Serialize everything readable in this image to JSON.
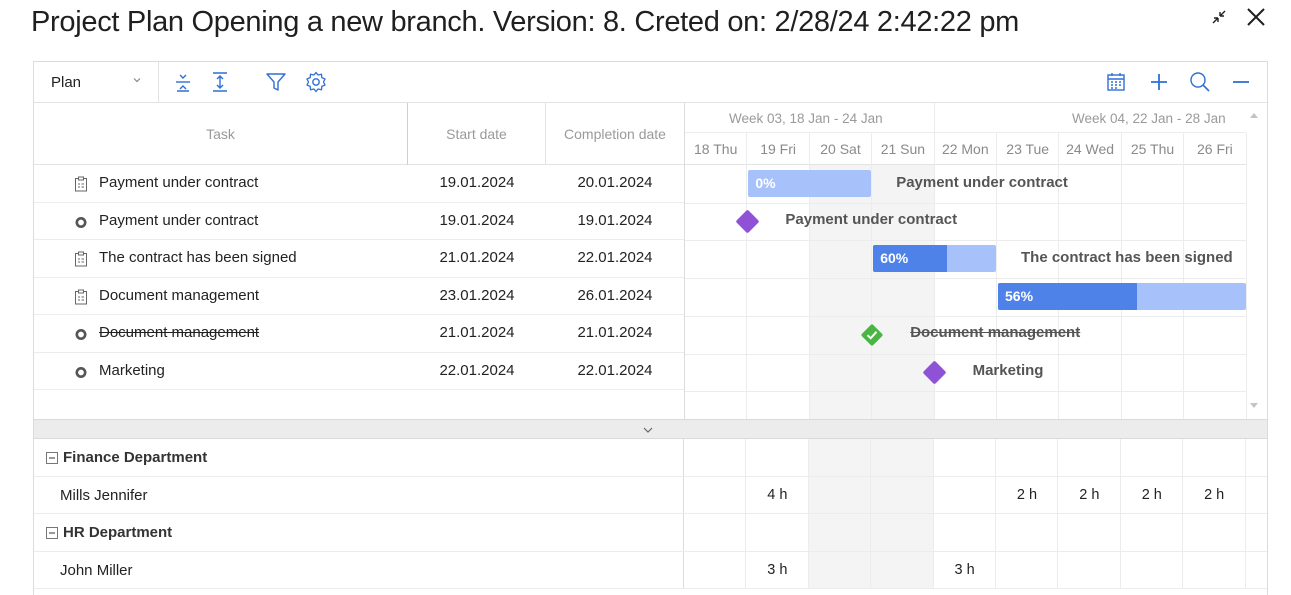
{
  "window": {
    "title": "Project Plan Opening a new branch. Version: 8. Creted on: 2/28/24 2:42:22 pm"
  },
  "toolbar": {
    "plan_select_value": "Plan"
  },
  "grid": {
    "columns": {
      "task": "Task",
      "start": "Start date",
      "end": "Completion date"
    },
    "rows": [
      {
        "name": "Payment under contract",
        "start": "19.01.2024",
        "end": "20.01.2024",
        "icon": "clipboard-task-icon",
        "strike": false
      },
      {
        "name": "Payment under contract",
        "start": "19.01.2024",
        "end": "19.01.2024",
        "icon": "milestone-dot-icon",
        "strike": false
      },
      {
        "name": "The contract has been signed",
        "start": "21.01.2024",
        "end": "22.01.2024",
        "icon": "clipboard-task-icon",
        "strike": false
      },
      {
        "name": "Document management",
        "start": "23.01.2024",
        "end": "26.01.2024",
        "icon": "clipboard-task-icon",
        "strike": false
      },
      {
        "name": "Document management",
        "start": "21.01.2024",
        "end": "21.01.2024",
        "icon": "milestone-dot-icon",
        "strike": true
      },
      {
        "name": "Marketing",
        "start": "22.01.2024",
        "end": "22.01.2024",
        "icon": "milestone-dot-icon",
        "strike": false
      }
    ]
  },
  "timeline": {
    "weeks": [
      {
        "label": "Week 03, 18 Jan - 24 Jan"
      },
      {
        "label": "Week 04, 22 Jan - 28 Jan"
      }
    ],
    "days": [
      "18 Thu",
      "19 Fri",
      "20 Sat",
      "21 Sun",
      "22 Mon",
      "23 Tue",
      "24 Wed",
      "25 Thu",
      "26 Fri"
    ],
    "weekend_days": [
      "20 Sat",
      "21 Sun"
    ],
    "bars": [
      {
        "label": "Payment under contract",
        "progress": 0,
        "progress_text": "0%"
      },
      {
        "label": "The contract has been signed",
        "progress": 0.6,
        "progress_text": "60%"
      },
      {
        "label": "",
        "progress": 0.56,
        "progress_text": "56%"
      }
    ],
    "milestones": [
      {
        "label": "Payment under contract",
        "state": "pending"
      },
      {
        "label": "Document management",
        "state": "done"
      },
      {
        "label": "Marketing",
        "state": "pending"
      }
    ],
    "colors": {
      "bar_bg": "#a7c1fb",
      "bar_fill": "#4f82e8",
      "milestone": "#8f52d6",
      "done": "#4bb543",
      "weekend": "#f4f4f4"
    }
  },
  "resources": {
    "groups": [
      {
        "name": "Finance Department",
        "people": [
          {
            "name": "Mills Jennifer",
            "hours": [
              "",
              "4 h",
              "",
              "",
              "",
              "2 h",
              "2 h",
              "2 h",
              "2 h"
            ]
          }
        ]
      },
      {
        "name": "HR Department",
        "people": [
          {
            "name": "John Miller",
            "hours": [
              "",
              "3 h",
              "",
              "",
              "3 h",
              "",
              "",
              "",
              ""
            ]
          }
        ]
      }
    ]
  }
}
